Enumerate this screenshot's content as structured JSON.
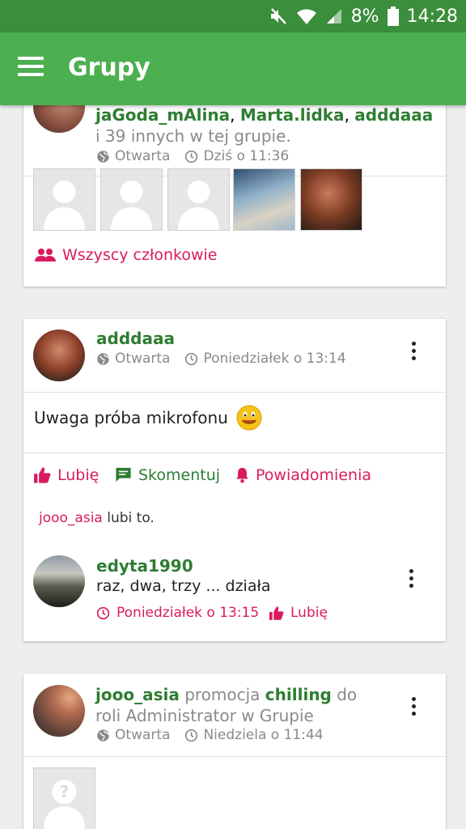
{
  "status_bar": {
    "battery": "8%",
    "time": "14:28"
  },
  "app_bar": {
    "title": "Grupy"
  },
  "card1": {
    "member1": "jaGoda_mAlina",
    "sep1": ",",
    "member2": "Marta.lidka",
    "sep2": ",",
    "member3": "adddaaa",
    "rest": "i 39 innych w tej grupie.",
    "privacy": "Otwarta",
    "time": "Dziś o 11:36",
    "all_members_label": "Wszyscy członkowie"
  },
  "post": {
    "author": "adddaaa",
    "privacy": "Otwarta",
    "time": "Poniedziałek o 13:14",
    "text": "Uwaga próba mikrofonu",
    "like_label": "Lubię",
    "comment_label": "Skomentuj",
    "notify_label": "Powiadomienia",
    "likes_user": "jooo_asia",
    "likes_suffix": "lubi to.",
    "comment": {
      "author": "edyta1990",
      "text": "raz, dwa, trzy ... działa",
      "time": "Poniedziałek o 13:15",
      "like_label": "Lubię"
    }
  },
  "card3": {
    "user": "jooo_asia",
    "verb": "promocja",
    "target": "chilling",
    "suffix": "do roli",
    "role": "Administrator w Grupie",
    "privacy": "Otwarta",
    "time": "Niedziela o 11:44"
  },
  "colors": {
    "primary": "#4caf50",
    "status": "#3b8e3b",
    "name_green": "#2e7d32",
    "accent_pink": "#d81b60"
  }
}
